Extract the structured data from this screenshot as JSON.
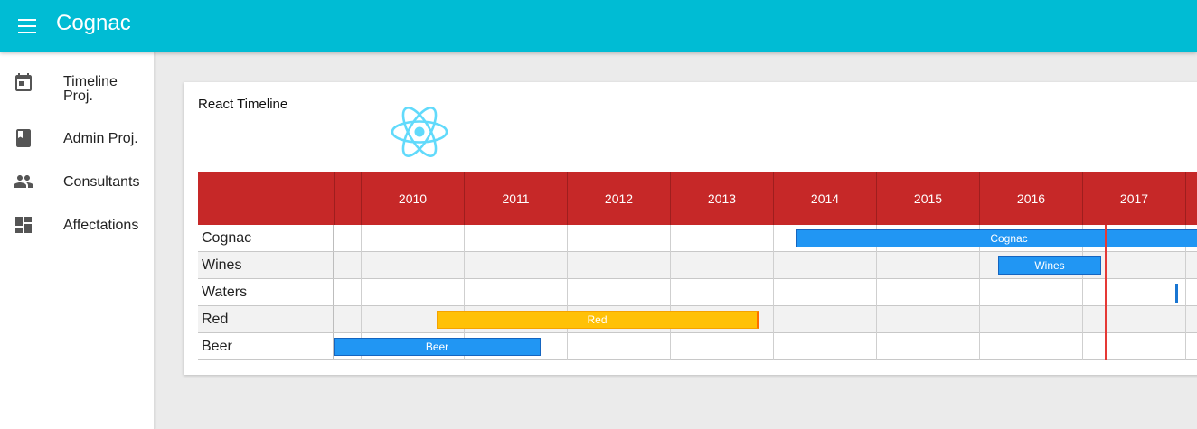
{
  "app": {
    "title": "Cognac"
  },
  "drawer": {
    "items": [
      {
        "label": "Timeline Proj.",
        "icon": "calendar-icon"
      },
      {
        "label": "Admin Proj.",
        "icon": "book-icon"
      },
      {
        "label": "Consultants",
        "icon": "people-icon"
      },
      {
        "label": "Affectations",
        "icon": "dashboard-icon"
      }
    ]
  },
  "card": {
    "title": "React Timeline"
  },
  "timeline": {
    "years": [
      "2010",
      "2011",
      "2012",
      "2013",
      "2014",
      "2015",
      "2016",
      "2017"
    ],
    "rows": [
      {
        "label": "Cognac"
      },
      {
        "label": "Wines"
      },
      {
        "label": "Waters"
      },
      {
        "label": "Red"
      },
      {
        "label": "Beer"
      }
    ],
    "items": [
      {
        "label": "Cognac",
        "color": "#2196f3"
      },
      {
        "label": "Wines",
        "color": "#2196f3"
      },
      {
        "label": "Red",
        "color": "#ffc107"
      },
      {
        "label": "Beer",
        "color": "#2196f3"
      }
    ]
  },
  "colors": {
    "appbar": "#00bcd4",
    "header": "#c62828",
    "bar_blue": "#2196f3",
    "bar_amber": "#ffc107",
    "now_line": "#e53935"
  }
}
